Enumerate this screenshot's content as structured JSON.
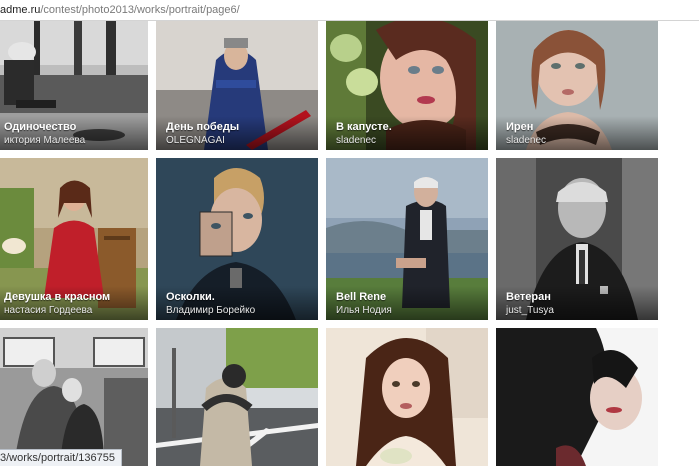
{
  "browser": {
    "url_domain": "adme.ru",
    "url_path": "/contest/photo2013/works/portrait/page6/",
    "status_url": "3/works/portrait/136755"
  },
  "tiles": [
    {
      "title": "Одиночество",
      "author": "иктория Малеева"
    },
    {
      "title": "День победы",
      "author": "OLEGNAGAI"
    },
    {
      "title": "В капусте.",
      "author": "sladenec"
    },
    {
      "title": "Ирен",
      "author": "sladenec"
    },
    {
      "title": "Девушка в красном",
      "author": "настасия Гордеева"
    },
    {
      "title": "Осколки.",
      "author": "Владимир Борейко"
    },
    {
      "title": "Bell Rene",
      "author": "Илья Нодия"
    },
    {
      "title": "Ветеран",
      "author": "just_Tusya"
    },
    {
      "title": "",
      "author": ""
    },
    {
      "title": "",
      "author": ""
    },
    {
      "title": "",
      "author": ""
    },
    {
      "title": "",
      "author": ""
    }
  ]
}
